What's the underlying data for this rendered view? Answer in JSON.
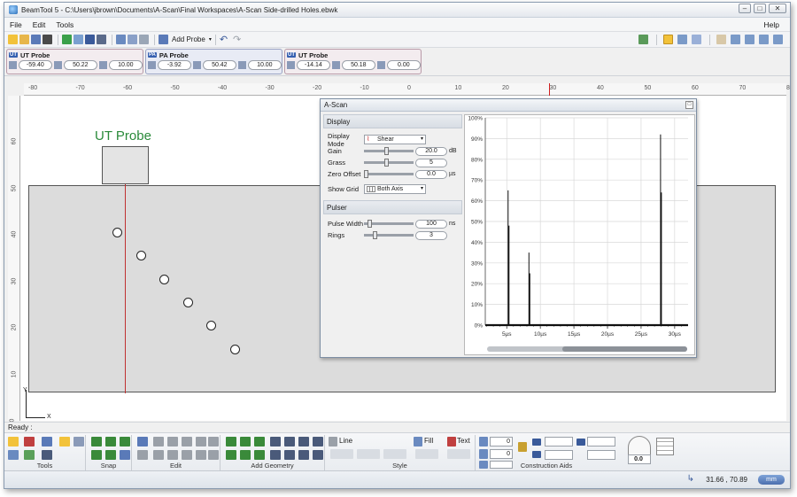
{
  "window": {
    "title": "BeamTool 5 - C:\\Users\\jbrown\\Documents\\A-Scan\\Final Workspaces\\A-Scan Side-drilled Holes.ebwk",
    "buttons": [
      "–",
      "□",
      "✕"
    ]
  },
  "menu": {
    "items": [
      "File",
      "Edit",
      "Tools"
    ],
    "help": "Help"
  },
  "toolbar": {
    "add_probe": "Add Probe"
  },
  "probes": [
    {
      "type": "UT",
      "name": "UT Probe",
      "values": [
        "-59.40",
        "50.22",
        "10.00"
      ]
    },
    {
      "type": "PA",
      "name": "PA Probe",
      "values": [
        "-3.92",
        "50.42",
        "10.00"
      ]
    },
    {
      "type": "UT",
      "name": "UT Probe",
      "values": [
        "-14.14",
        "50.18",
        "0.00"
      ]
    }
  ],
  "ruler": {
    "h_labels": [
      "-80",
      "-70",
      "-60",
      "-50",
      "-40",
      "-30",
      "-20",
      "-10",
      "0",
      "10",
      "20",
      "30",
      "40",
      "50",
      "60",
      "70",
      "80"
    ],
    "v_labels": [
      "60",
      "50",
      "40",
      "30",
      "20",
      "10",
      "0"
    ]
  },
  "canvas": {
    "probe_label": "UT Probe",
    "axis_y": "Y",
    "axis_x": "X"
  },
  "ascan": {
    "title": "A-Scan",
    "display_section": "Display",
    "display_mode_label": "Display Mode",
    "display_mode_value": "Shear",
    "gain_label": "Gain",
    "gain_value": "20.0",
    "gain_unit": "dB",
    "gain_level": 0.45,
    "grass_label": "Grass",
    "grass_value": "5",
    "grass_level": 0.45,
    "zero_offset_label": "Zero Offset",
    "zero_offset_value": "0.0",
    "zero_offset_unit": "µs",
    "zero_offset_level": 0.0,
    "show_grid_label": "Show Grid",
    "show_grid_value": "Both Axis",
    "pulser_section": "Pulser",
    "pulse_width_label": "Pulse Width",
    "pulse_width_value": "100",
    "pulse_width_unit": "ns",
    "pulse_width_level": 0.08,
    "rings_label": "Rings",
    "rings_value": "3",
    "rings_level": 0.2
  },
  "chart_data": {
    "type": "line",
    "xlabel": "",
    "ylabel": "",
    "x_ticks": [
      "5µs",
      "10µs",
      "15µs",
      "20µs",
      "25µs",
      "30µs"
    ],
    "y_ticks": [
      "0%",
      "10%",
      "20%",
      "30%",
      "40%",
      "50%",
      "60%",
      "70%",
      "80%",
      "90%",
      "100%"
    ],
    "xlim": [
      1.8,
      32
    ],
    "ylim": [
      0,
      100
    ],
    "grid": true,
    "peaks": [
      {
        "x": 5.2,
        "values": [
          65,
          48
        ]
      },
      {
        "x": 8.3,
        "values": [
          35,
          25
        ]
      },
      {
        "x": 27.9,
        "values": [
          92,
          64
        ]
      }
    ]
  },
  "status": {
    "text": "Ready :"
  },
  "ribbon": {
    "groups": [
      "Tools",
      "Snap",
      "Edit",
      "Add Geometry",
      "Style",
      "Construction Aids"
    ],
    "line_label": "Line",
    "fill_label": "Fill",
    "text_label": "Text",
    "ca_values": [
      "0",
      "0"
    ],
    "angle_value": "0.0"
  },
  "bottom": {
    "coords": "31.66 , 70.89",
    "unit": "mm"
  }
}
